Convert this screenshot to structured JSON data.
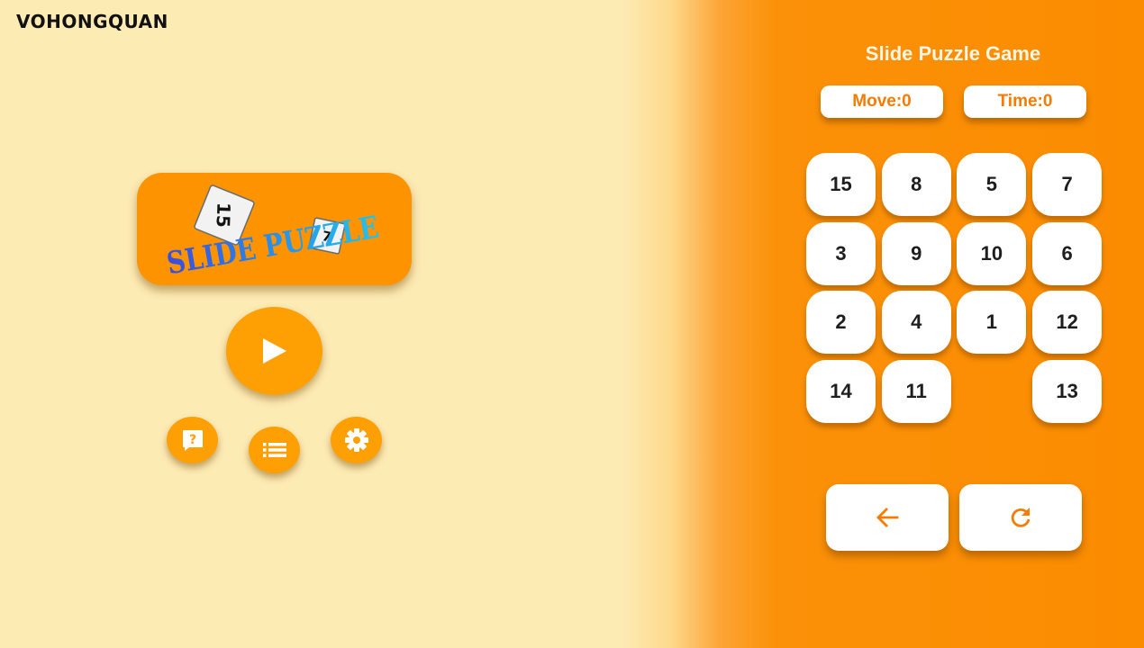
{
  "brand": {
    "name": "VOHONGQUAN"
  },
  "menu": {
    "logo_text": "SLIDE PUZZLE",
    "logo_tile_numbers": [
      "15",
      "7"
    ],
    "play_icon": "play-icon",
    "help_icon": "help-icon",
    "list_icon": "list-icon",
    "settings_icon": "gear-icon"
  },
  "game": {
    "title": "Slide Puzzle Game",
    "moves_label": "Move:0",
    "time_label": "Time:0",
    "tiles": [
      "15",
      "8",
      "5",
      "7",
      "3",
      "9",
      "10",
      "6",
      "2",
      "4",
      "1",
      "12",
      "14",
      "11",
      "",
      "13"
    ],
    "back_icon": "arrow-left-icon",
    "restart_icon": "refresh-icon"
  },
  "colors": {
    "menu_background": "#fdebb4",
    "panel_background": "#fb8c00",
    "button_orange": "#fea003",
    "accent_text": "#f57c00"
  }
}
